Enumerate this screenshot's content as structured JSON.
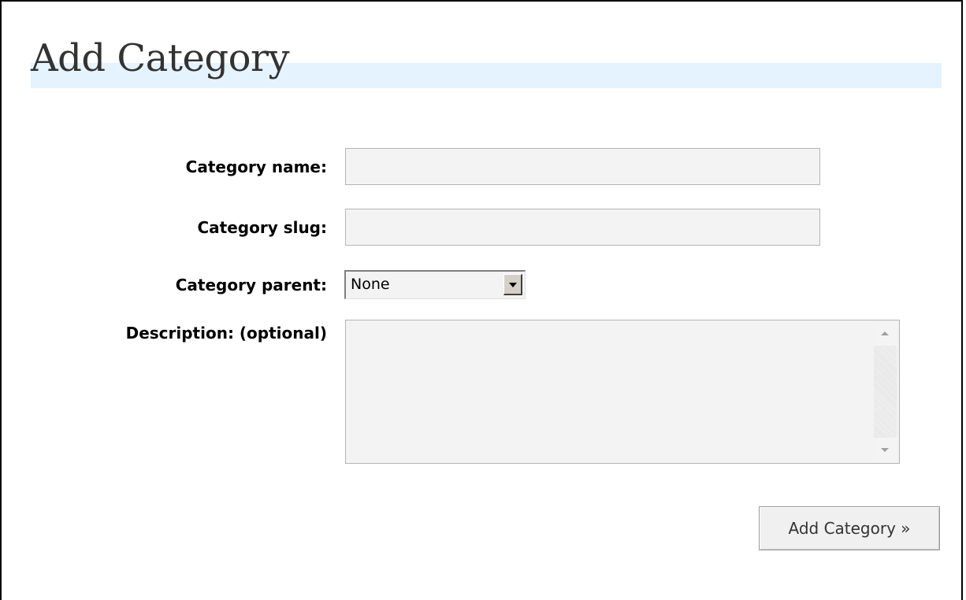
{
  "page": {
    "title": "Add Category"
  },
  "form": {
    "name": {
      "label": "Category name:",
      "value": ""
    },
    "slug": {
      "label": "Category slug:",
      "value": ""
    },
    "parent": {
      "label": "Category parent:",
      "selected": "None"
    },
    "description": {
      "label": "Description: (optional)",
      "value": ""
    },
    "submit_label": "Add Category »"
  },
  "colors": {
    "title_band": "#e5f3ff",
    "title_text": "#333333",
    "field_background": "#f3f3f3"
  },
  "icons": {
    "select_arrow": "chevron-down-icon",
    "scroll_up": "scroll-up-arrow-icon",
    "scroll_down": "scroll-down-arrow-icon"
  }
}
